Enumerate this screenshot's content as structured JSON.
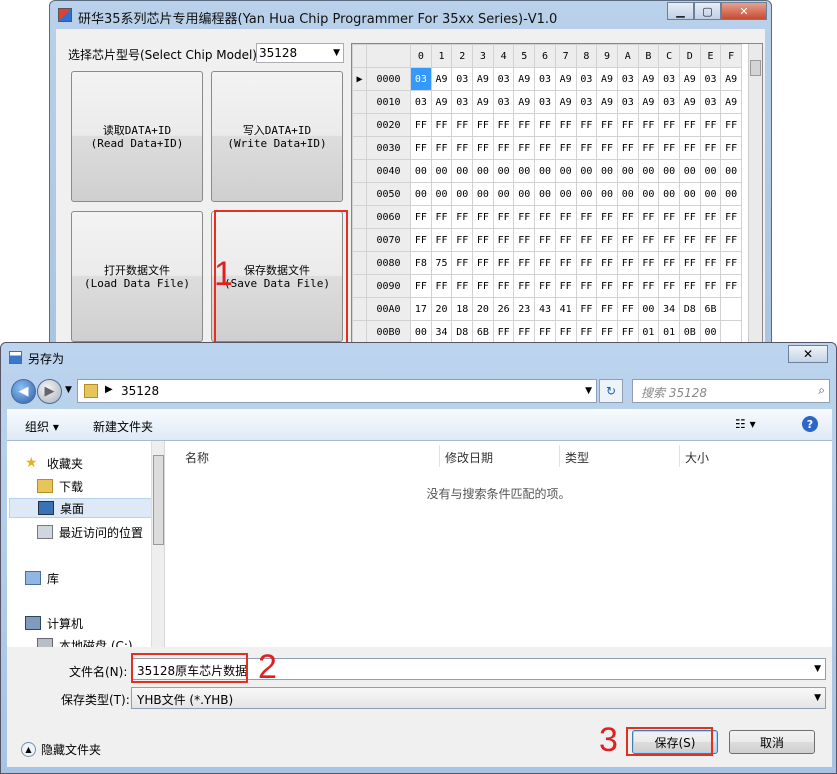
{
  "programmer": {
    "title": "研华35系列芯片专用编程器(Yan Hua Chip Programmer For 35xx Series)-V1.0",
    "chip_label": "选择芯片型号(Select Chip Model)",
    "chip_value": "35128",
    "buttons": {
      "read": [
        "读取DATA+ID",
        "(Read Data+ID)"
      ],
      "write": [
        "写入DATA+ID",
        "(Write Data+ID)"
      ],
      "load": [
        "打开数据文件",
        "(Load Data File)"
      ],
      "save": [
        "保存数据文件",
        "(Save Data File)"
      ]
    },
    "hex": {
      "columns": [
        "0",
        "1",
        "2",
        "3",
        "4",
        "5",
        "6",
        "7",
        "8",
        "9",
        "A",
        "B",
        "C",
        "D",
        "E",
        "F"
      ],
      "rows": [
        {
          "addr": "0000",
          "cells": [
            "03",
            "A9",
            "03",
            "A9",
            "03",
            "A9",
            "03",
            "A9",
            "03",
            "A9",
            "03",
            "A9",
            "03",
            "A9",
            "03",
            "A9"
          ]
        },
        {
          "addr": "0010",
          "cells": [
            "03",
            "A9",
            "03",
            "A9",
            "03",
            "A9",
            "03",
            "A9",
            "03",
            "A9",
            "03",
            "A9",
            "03",
            "A9",
            "03",
            "A9"
          ]
        },
        {
          "addr": "0020",
          "cells": [
            "FF",
            "FF",
            "FF",
            "FF",
            "FF",
            "FF",
            "FF",
            "FF",
            "FF",
            "FF",
            "FF",
            "FF",
            "FF",
            "FF",
            "FF",
            "FF"
          ]
        },
        {
          "addr": "0030",
          "cells": [
            "FF",
            "FF",
            "FF",
            "FF",
            "FF",
            "FF",
            "FF",
            "FF",
            "FF",
            "FF",
            "FF",
            "FF",
            "FF",
            "FF",
            "FF",
            "FF"
          ]
        },
        {
          "addr": "0040",
          "cells": [
            "00",
            "00",
            "00",
            "00",
            "00",
            "00",
            "00",
            "00",
            "00",
            "00",
            "00",
            "00",
            "00",
            "00",
            "00",
            "00"
          ]
        },
        {
          "addr": "0050",
          "cells": [
            "00",
            "00",
            "00",
            "00",
            "00",
            "00",
            "00",
            "00",
            "00",
            "00",
            "00",
            "00",
            "00",
            "00",
            "00",
            "00"
          ]
        },
        {
          "addr": "0060",
          "cells": [
            "FF",
            "FF",
            "FF",
            "FF",
            "FF",
            "FF",
            "FF",
            "FF",
            "FF",
            "FF",
            "FF",
            "FF",
            "FF",
            "FF",
            "FF",
            "FF"
          ]
        },
        {
          "addr": "0070",
          "cells": [
            "FF",
            "FF",
            "FF",
            "FF",
            "FF",
            "FF",
            "FF",
            "FF",
            "FF",
            "FF",
            "FF",
            "FF",
            "FF",
            "FF",
            "FF",
            "FF"
          ]
        },
        {
          "addr": "0080",
          "cells": [
            "F8",
            "75",
            "FF",
            "FF",
            "FF",
            "FF",
            "FF",
            "FF",
            "FF",
            "FF",
            "FF",
            "FF",
            "FF",
            "FF",
            "FF",
            "FF"
          ]
        },
        {
          "addr": "0090",
          "cells": [
            "FF",
            "FF",
            "FF",
            "FF",
            "FF",
            "FF",
            "FF",
            "FF",
            "FF",
            "FF",
            "FF",
            "FF",
            "FF",
            "FF",
            "FF",
            "FF"
          ]
        },
        {
          "addr": "00A0",
          "cells": [
            "17",
            "20",
            "18",
            "20",
            "26",
            "23",
            "43",
            "41",
            "FF",
            "FF",
            "FF",
            "00",
            "34",
            "D8",
            "6B"
          ]
        },
        {
          "addr": "00B0",
          "cells": [
            "00",
            "34",
            "D8",
            "6B",
            "FF",
            "FF",
            "FF",
            "FF",
            "FF",
            "FF",
            "FF",
            "01",
            "01",
            "0B",
            "00"
          ]
        }
      ],
      "row_marker": "▶"
    }
  },
  "annotations": {
    "step1": "1",
    "step2": "2",
    "step3": "3"
  },
  "dialog": {
    "title": "另存为",
    "close": "✕",
    "address_path": "35128",
    "search_placeholder": "搜索 35128",
    "toolbar": {
      "organize": "组织 ▾",
      "new_folder": "新建文件夹",
      "view": "☷ ▾",
      "help": "?"
    },
    "nav_items": [
      {
        "label": "收藏夹",
        "icon": "star-icon"
      },
      {
        "label": "下载",
        "icon": "download-folder-icon"
      },
      {
        "label": "桌面",
        "icon": "desktop-icon"
      },
      {
        "label": "最近访问的位置",
        "icon": "recent-places-icon"
      },
      {
        "label": "库",
        "icon": "library-icon"
      },
      {
        "label": "计算机",
        "icon": "computer-icon"
      },
      {
        "label": "本地磁盘 (C:)",
        "icon": "disk-icon"
      }
    ],
    "columns": [
      "名称",
      "修改日期",
      "类型",
      "大小"
    ],
    "empty_message": "没有与搜索条件匹配的项。",
    "filename_label": "文件名(N):",
    "filename_value": "35128原车芯片数据",
    "filetype_label": "保存类型(T):",
    "filetype_value": "YHB文件 (*.YHB)",
    "hide_folders": "隐藏文件夹",
    "save_button": "保存(S)",
    "cancel_button": "取消"
  },
  "colors": {
    "annotation_red": "#e53020",
    "selection_blue": "#3399ff"
  }
}
